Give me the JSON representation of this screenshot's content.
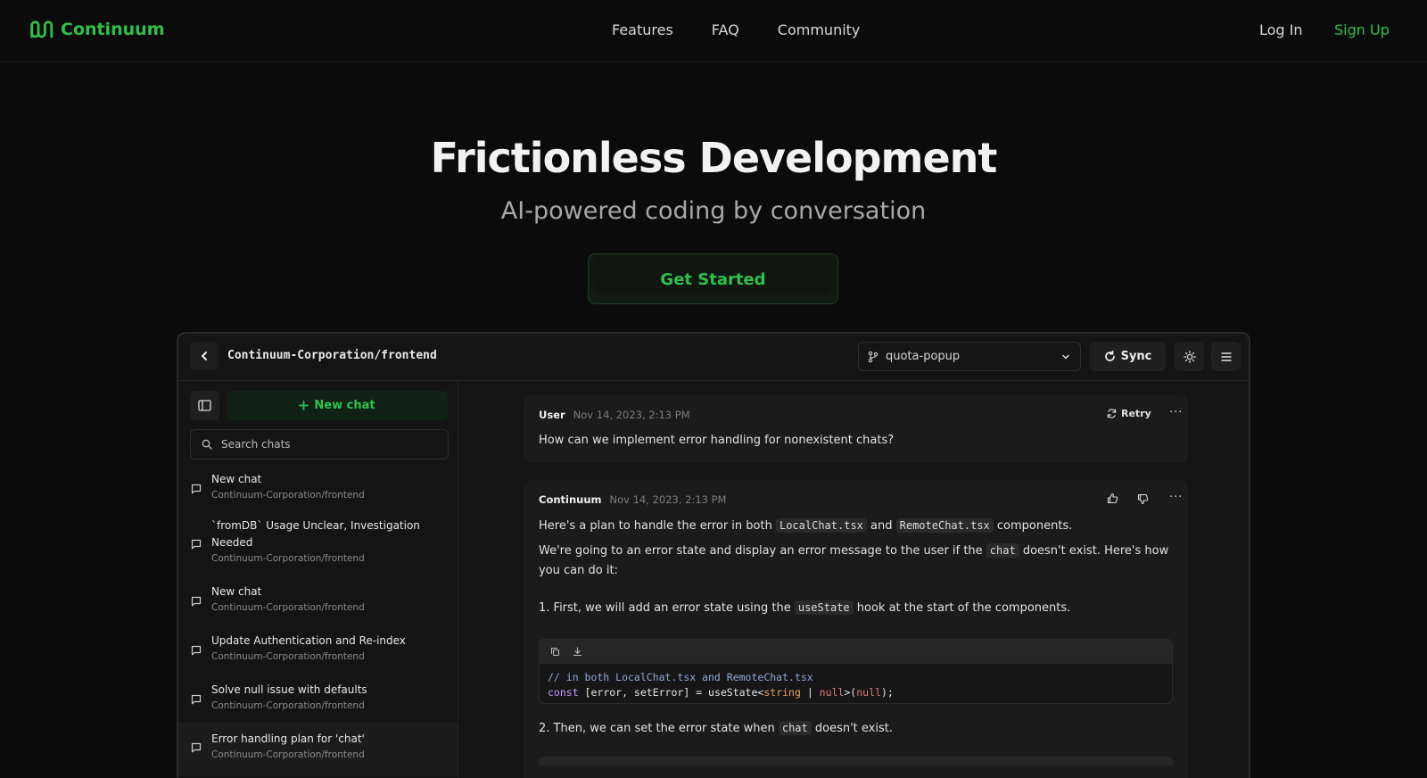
{
  "nav": {
    "brand": "Continuum",
    "links": [
      "Features",
      "FAQ",
      "Community"
    ],
    "login": "Log In",
    "signup": "Sign Up"
  },
  "hero": {
    "title": "Frictionless Development",
    "subtitle": "AI-powered coding by conversation",
    "cta": "Get Started"
  },
  "app": {
    "repo": "Continuum-Corporation/frontend",
    "branch": "quota-popup",
    "sync": "Sync",
    "sidebar": {
      "new_chat": "New chat",
      "search_placeholder": "Search chats",
      "chats": [
        {
          "title": "New chat",
          "repo": "Continuum-Corporation/frontend"
        },
        {
          "title": "`fromDB` Usage Unclear, Investigation Needed",
          "repo": "Continuum-Corporation/frontend"
        },
        {
          "title": "New chat",
          "repo": "Continuum-Corporation/frontend"
        },
        {
          "title": "Update Authentication and Re-index",
          "repo": "Continuum-Corporation/frontend"
        },
        {
          "title": "Solve null issue with defaults",
          "repo": "Continuum-Corporation/frontend"
        },
        {
          "title": "Error handling plan for 'chat'",
          "repo": "Continuum-Corporation/frontend"
        }
      ]
    },
    "messages": {
      "user": {
        "author": "User",
        "time": "Nov 14, 2023, 2:13 PM",
        "retry": "Retry",
        "text": "How can we implement error handling for nonexistent chats?"
      },
      "assistant": {
        "author": "Continuum",
        "time": "Nov 14, 2023, 2:13 PM",
        "p1_a": "Here's a plan to handle the error in both ",
        "p1_code1": "LocalChat.tsx",
        "p1_b": " and ",
        "p1_code2": "RemoteChat.tsx",
        "p1_c": " components.",
        "p2_a": "We're going to an error state and display an error message to the user if the ",
        "p2_code": "chat",
        "p2_b": " doesn't exist. Here's how you can do it:",
        "step1_a": "1. First, we will add an error state using the ",
        "step1_code": "useState",
        "step1_b": " hook at the start of the components.",
        "code_comment": "// in both LocalChat.tsx and RemoteChat.tsx",
        "code_kw": "const",
        "code_mid": " [error, setError] = useState<",
        "code_type": "string",
        "code_pipe": " | ",
        "code_null1": "null",
        "code_close": ">(",
        "code_null2": "null",
        "code_end": ");",
        "step2_a": "2. Then, we can set the error state when ",
        "step2_code": "chat",
        "step2_b": " doesn't exist."
      }
    }
  },
  "colors": {
    "accent": "#2ec24a",
    "background": "#0b0b0b",
    "panel": "#141414"
  }
}
